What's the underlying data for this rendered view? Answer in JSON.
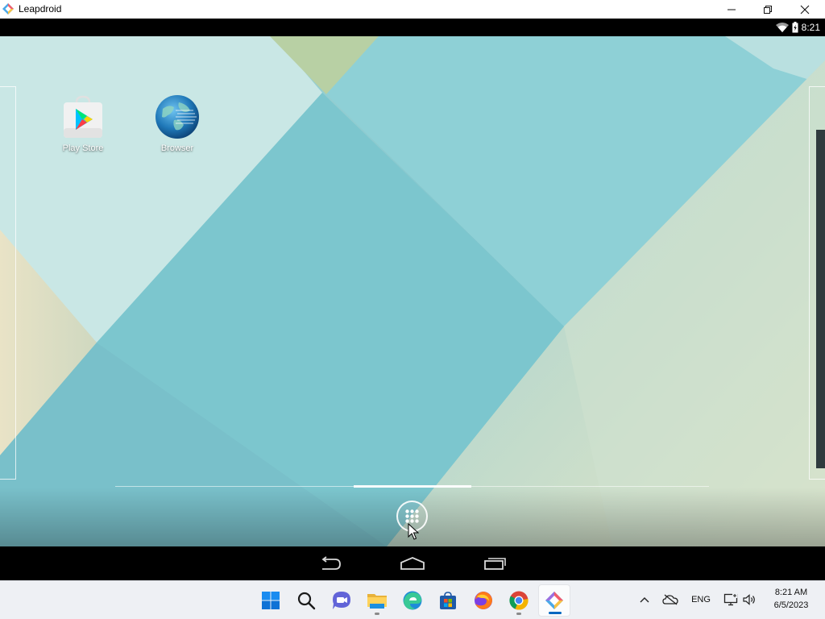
{
  "window": {
    "title": "Leapdroid",
    "controls": [
      "minimize-icon",
      "restore-icon",
      "close-icon"
    ]
  },
  "android_status": {
    "time": "8:21",
    "icons": [
      "wifi-icon",
      "battery-charging-icon"
    ]
  },
  "home_screen": {
    "apps": [
      {
        "label": "Play Store",
        "icon": "play-store-icon"
      },
      {
        "label": "Browser",
        "icon": "browser-globe-icon"
      }
    ],
    "all_apps_icon": "all-apps-grid-icon"
  },
  "android_nav": {
    "buttons": [
      "back-icon",
      "home-icon",
      "recent-apps-icon"
    ]
  },
  "taskbar": {
    "apps": [
      {
        "name": "start",
        "icon": "windows-start-icon"
      },
      {
        "name": "search",
        "icon": "search-icon"
      },
      {
        "name": "chat",
        "icon": "teams-chat-icon"
      },
      {
        "name": "file-explorer",
        "icon": "folder-icon",
        "running": true
      },
      {
        "name": "edge",
        "icon": "edge-icon"
      },
      {
        "name": "store",
        "icon": "store-icon"
      },
      {
        "name": "firefox",
        "icon": "firefox-icon"
      },
      {
        "name": "chrome",
        "icon": "chrome-icon",
        "running": true
      },
      {
        "name": "leapdroid",
        "icon": "leapdroid-icon",
        "active": true
      }
    ],
    "tray": {
      "language": "ENG",
      "icons": [
        "chevron-up-icon",
        "onedrive-offline-icon",
        "network-icon",
        "volume-icon"
      ]
    },
    "clock": {
      "time": "8:21 AM",
      "date": "6/5/2023"
    }
  },
  "colors": {
    "wallpaper_teal": "#7fc8d0",
    "wallpaper_pale": "#c7e6e4",
    "taskbar_bg": "#eef0f4",
    "accent": "#0067c0"
  }
}
